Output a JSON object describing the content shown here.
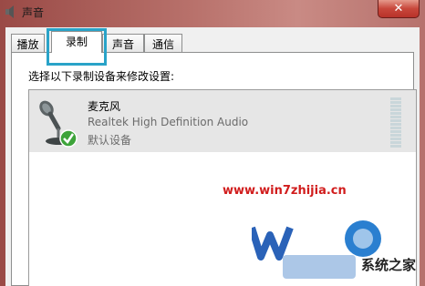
{
  "window": {
    "title": "声音",
    "close_label": "✕"
  },
  "tabs": [
    {
      "label": "播放",
      "active": false
    },
    {
      "label": "录制",
      "active": true
    },
    {
      "label": "声音",
      "active": false
    },
    {
      "label": "通信",
      "active": false
    }
  ],
  "recording": {
    "instruction": "选择以下录制设备来修改设置:",
    "devices": [
      {
        "name": "麦克风",
        "description": "Realtek High Definition Audio",
        "status": "默认设备",
        "icon": "microphone-icon",
        "badge_icon": "default-check-icon"
      }
    ]
  },
  "watermark": {
    "url": "www.win7zhijia.cn",
    "site_name": "系统之家"
  },
  "colors": {
    "highlight": "#29a3c8",
    "check_green": "#3da33a",
    "watermark_red": "#d11d1d"
  }
}
